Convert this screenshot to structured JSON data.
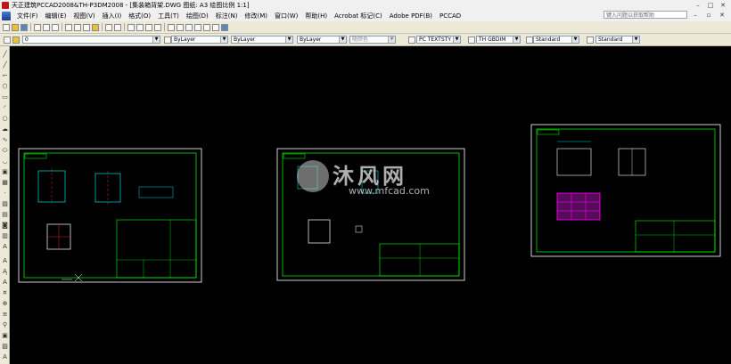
{
  "window": {
    "title": "天正建筑PCCAD2008&TH-P3DM2008 - [集装箱背架.DWG 图纸: A3 绘图比例 1:1]"
  },
  "menubar": {
    "items": [
      "文件(F)",
      "编辑(E)",
      "视图(V)",
      "插入(I)",
      "格式(O)",
      "工具(T)",
      "绘图(D)",
      "标注(N)",
      "修改(M)",
      "窗口(W)",
      "帮助(H)",
      "Acrobat 标记(C)",
      "Adobe PDF(B)",
      "PCCAD"
    ],
    "help_search_placeholder": "键入问题以获取帮助"
  },
  "toolbar2": {
    "layer": "0",
    "color": "ByLayer",
    "linetype": "ByLayer",
    "lineweight": "ByLayer",
    "plotstyle": "随颜色",
    "text_style": "PC TEXTSTY",
    "dim_style": "TH GBDIM",
    "table_style": "Standard",
    "multileader_style": "Standard"
  },
  "watermark": {
    "brand": "沐风网",
    "url": "www.mfcad.com"
  },
  "colors": {
    "canvas_bg": "#000000",
    "frame": "#ffffff",
    "drawing": "#00ffff",
    "title_block": "#00ff00",
    "highlight_text": "#ffff00",
    "part_magenta": "#ff00ff"
  }
}
